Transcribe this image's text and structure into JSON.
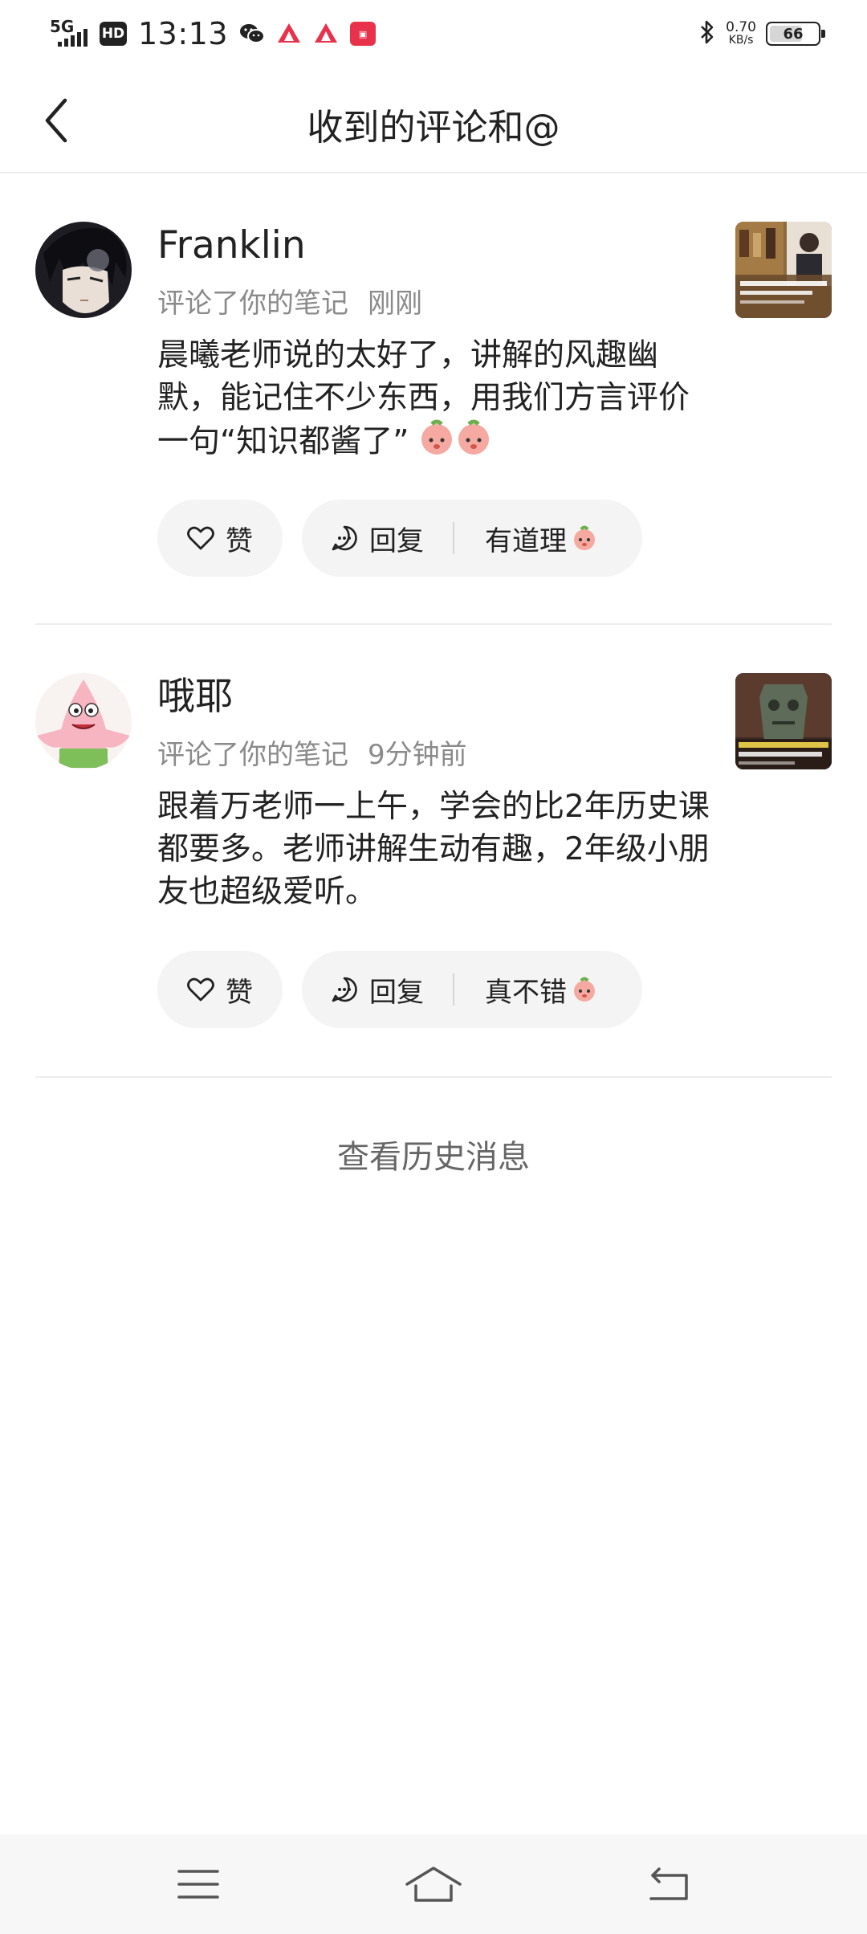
{
  "status_bar": {
    "network": "5G",
    "hd": "HD",
    "time": "13:13",
    "speed_value": "0.70",
    "speed_unit": "KB/s",
    "battery": "66",
    "icons": [
      "wechat-icon",
      "app-icon",
      "app-icon",
      "app-icon"
    ]
  },
  "header": {
    "title": "收到的评论和@",
    "back_icon": "chevron-left-icon"
  },
  "comments": [
    {
      "name": "Franklin",
      "action": "评论了你的笔记",
      "time": "刚刚",
      "text": "晨曦老师说的太好了，讲解的风趣幽默，能记住不少东西，用我们方言评价一句“知识都酱了”",
      "like_label": "赞",
      "reply_label": "回复",
      "quick_reply": "有道理"
    },
    {
      "name": "哦耶",
      "action": "评论了你的笔记",
      "time": "9分钟前",
      "text": "跟着万老师一上午，学会的比2年历史课都要多。老师讲解生动有趣，2年级小朋友也超级爱听。",
      "like_label": "赞",
      "reply_label": "回复",
      "quick_reply": "真不错"
    }
  ],
  "history_label": "查看历史消息",
  "navbar": {
    "icons": [
      "menu-icon",
      "home-icon",
      "back-icon"
    ]
  }
}
